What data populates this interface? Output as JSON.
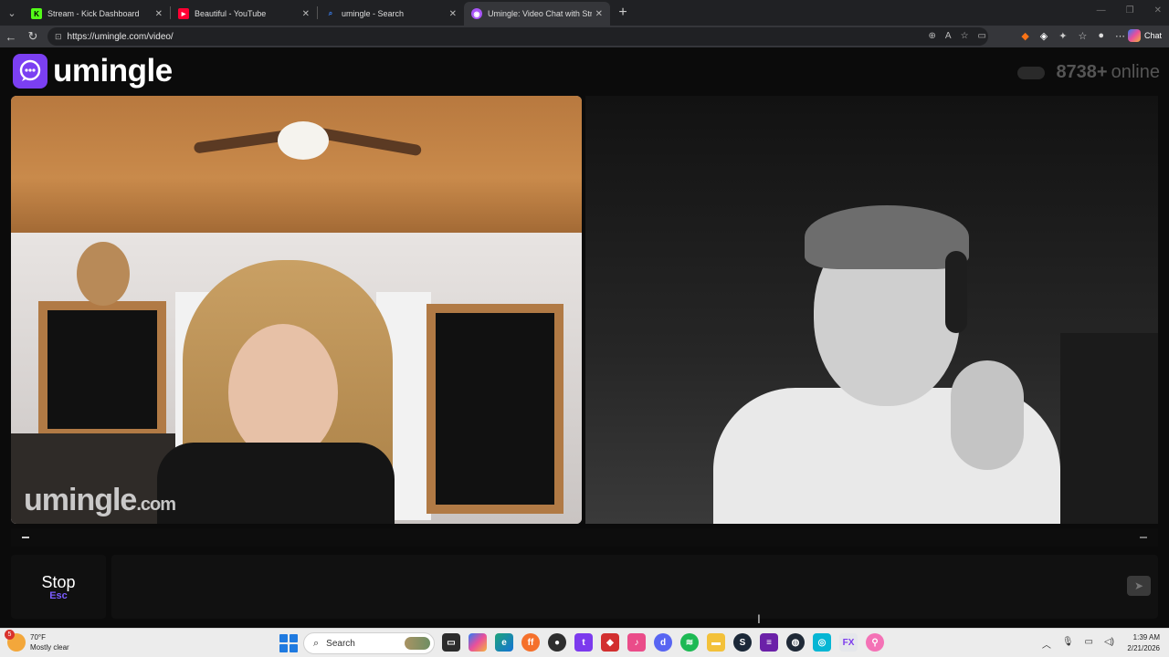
{
  "browser": {
    "tabs": [
      {
        "title": "Stream - Kick Dashboard",
        "favicon": "K",
        "favicon_color": "#53fc18",
        "active": false
      },
      {
        "title": "Beautiful - YouTube",
        "favicon": "▶",
        "favicon_color": "#ff0033",
        "active": false
      },
      {
        "title": "umingle - Search",
        "favicon": "⌕",
        "favicon_color": "#3b82f6",
        "active": false
      },
      {
        "title": "Umingle: Video Chat with Stra",
        "favicon": "◉",
        "favicon_color": "#a855f7",
        "active": true
      }
    ],
    "new_tab": "+",
    "url": "https://umingle.com/video/",
    "chat_label": "Chat"
  },
  "page": {
    "logo_text": "umingle",
    "online_count": "8738+",
    "online_label": "online",
    "watermark": "umingle",
    "watermark_suffix": ".com",
    "stop_label": "Stop",
    "stop_key": "Esc",
    "message_placeholder": ""
  },
  "taskbar": {
    "weather_badge": "5",
    "temperature": "70°F",
    "weather_desc": "Mostly clear",
    "search_label": "Search",
    "time": "1:39 AM",
    "date": "2/21/2026"
  },
  "colors": {
    "brand": "#7b3ff2",
    "page_bg": "#0b0b0b",
    "esc_accent": "#7b5cff"
  }
}
